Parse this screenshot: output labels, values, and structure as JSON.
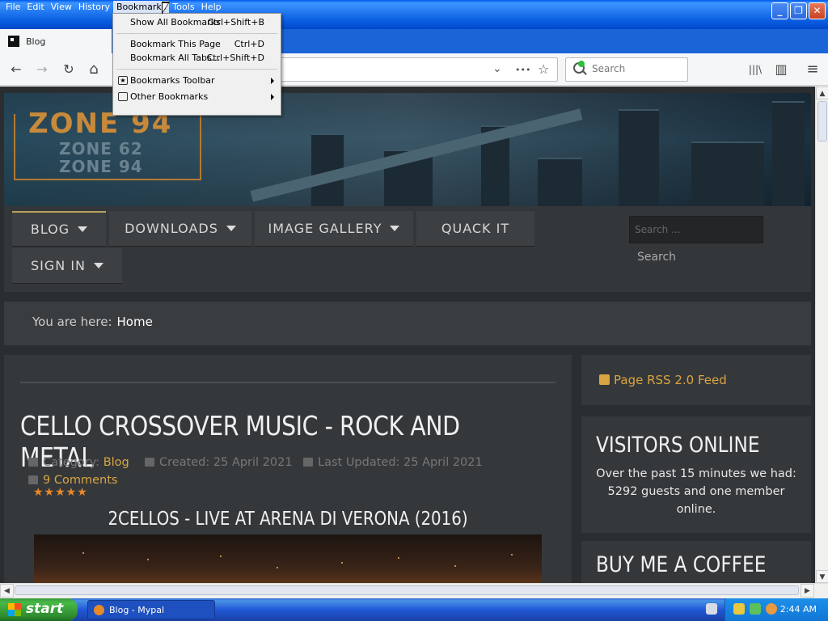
{
  "menubar": {
    "items": [
      "File",
      "Edit",
      "View",
      "History",
      "Bookmarks",
      "Tools",
      "Help"
    ]
  },
  "window_controls": {
    "minimize": "_",
    "maximize": "❐",
    "close": "✕"
  },
  "tab": {
    "title": "Blog"
  },
  "navbar": {
    "search_placeholder": "Search",
    "back": "←",
    "forward": "→",
    "reload": "↻",
    "home": "⌂",
    "library": "|||\\",
    "sidebar": "▥",
    "menu": "≡",
    "more": "•••",
    "star": "☆",
    "chev": "⌄"
  },
  "bookmarks_menu": {
    "show_all": {
      "label": "Show All Bookmarks",
      "shortcut": "Ctrl+Shift+B"
    },
    "bookmark_page": {
      "label": "Bookmark This Page",
      "shortcut": "Ctrl+D"
    },
    "bookmark_all_tabs": {
      "label": "Bookmark All Tabs...",
      "shortcut": "Ctrl+Shift+D"
    },
    "toolbar": {
      "label": "Bookmarks Toolbar"
    },
    "other": {
      "label": "Other Bookmarks"
    }
  },
  "site": {
    "logo_main": "ZONE 94",
    "logo_sub1": "ZONE 62",
    "logo_sub2": "ZONE 94",
    "nav": [
      "BLOG",
      "DOWNLOADS",
      "IMAGE GALLERY",
      "QUACK IT",
      "SIGN IN"
    ],
    "search_placeholder": "Search ...",
    "search_button": "Search",
    "breadcrumb_prefix": "You are here:",
    "breadcrumb_current": "Home"
  },
  "article": {
    "title": "CELLO CROSSOVER MUSIC - ROCK AND METAL",
    "category_label": "Category:",
    "category": "Blog",
    "created": "Created: 25 April 2021",
    "updated": "Last Updated: 25 April 2021",
    "comments": "9 Comments",
    "rating": "★★★★★",
    "video_title": "2CELLOS - LIVE AT ARENA DI VERONA (2016)"
  },
  "sidebar": {
    "rss": "Page RSS 2.0 Feed",
    "visitors_title": "VISITORS ONLINE",
    "visitors_text": "Over the past 15 minutes we had: 5292 guests and one member online.",
    "coffee_title": "BUY ME A COFFEE"
  },
  "scroll_arrows": {
    "up": "▲",
    "down": "▼",
    "left": "◀",
    "right": "▶"
  },
  "taskbar": {
    "start": "start",
    "task": "Blog - Mypal",
    "clock": "2:44 AM"
  }
}
